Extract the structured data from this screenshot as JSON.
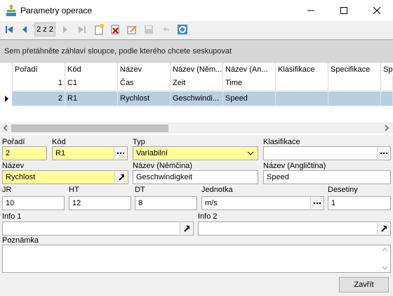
{
  "window": {
    "title": "Parametry operace"
  },
  "toolbar": {
    "pager": "2 z 2"
  },
  "grid": {
    "group_hint": "Sem přetáhněte záhlaví sloupce, podle kterého chcete seskupovat",
    "columns": [
      "Pořadí",
      "Kód",
      "Název",
      "Název (Něm...",
      "Název (An...",
      "Klasifikace",
      "Specifikace",
      "Sp"
    ],
    "rows": [
      [
        "1",
        "C1",
        "Čas",
        "Zeit",
        "Time",
        "",
        "",
        ""
      ],
      [
        "2",
        "R1",
        "Rychlost",
        "Geschwindi...",
        "Speed",
        "",
        "",
        ""
      ]
    ],
    "selected_row": 1
  },
  "form": {
    "poradi": {
      "label": "Pořadí",
      "value": "2"
    },
    "kod": {
      "label": "Kód",
      "value": "R1"
    },
    "typ": {
      "label": "Typ",
      "value": "Variabilní"
    },
    "klasifikace": {
      "label": "Klasifikace",
      "value": ""
    },
    "nazev": {
      "label": "Název",
      "value": "Rychlost"
    },
    "nazev_de": {
      "label": "Název (Němčina)",
      "value": "Geschwindigkeit"
    },
    "nazev_en": {
      "label": "Název (Angličtina)",
      "value": "Speed"
    },
    "jr": {
      "label": "JR",
      "value": "10"
    },
    "ht": {
      "label": "HT",
      "value": "12"
    },
    "dt": {
      "label": "DT",
      "value": "8"
    },
    "jednotka": {
      "label": "Jednotka",
      "value": "m/s"
    },
    "desetiny": {
      "label": "Desetiny",
      "value": "1"
    },
    "info1": {
      "label": "Info 1",
      "value": ""
    },
    "info2": {
      "label": "Info 2",
      "value": ""
    },
    "poznamka": {
      "label": "Poznámka",
      "value": ""
    }
  },
  "buttons": {
    "close": "Zavřít"
  },
  "colors": {
    "required_field": "#ffff99",
    "selected_row": "#b7cfe2",
    "nav_blue": "#2a6ec7"
  }
}
